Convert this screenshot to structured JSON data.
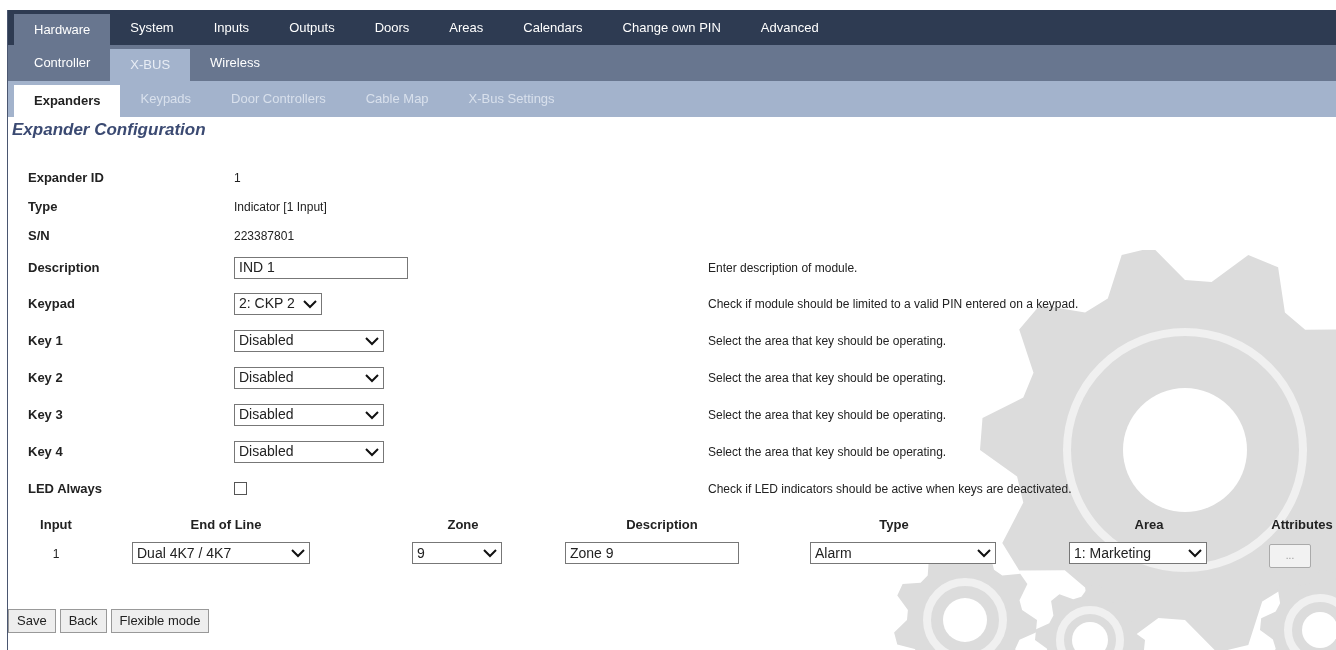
{
  "main_tabs": [
    {
      "label": "Hardware",
      "selected": true
    },
    {
      "label": "System",
      "selected": false
    },
    {
      "label": "Inputs",
      "selected": false
    },
    {
      "label": "Outputs",
      "selected": false
    },
    {
      "label": "Doors",
      "selected": false
    },
    {
      "label": "Areas",
      "selected": false
    },
    {
      "label": "Calendars",
      "selected": false
    },
    {
      "label": "Change own PIN",
      "selected": false
    },
    {
      "label": "Advanced",
      "selected": false
    }
  ],
  "sub_tabs": [
    {
      "label": "Controller",
      "selected": false
    },
    {
      "label": "X-BUS",
      "selected": true
    },
    {
      "label": "Wireless",
      "selected": false
    }
  ],
  "section_tabs": [
    {
      "label": "Expanders",
      "selected": true
    },
    {
      "label": "Keypads",
      "selected": false
    },
    {
      "label": "Door Controllers",
      "selected": false
    },
    {
      "label": "Cable Map",
      "selected": false
    },
    {
      "label": "X-Bus Settings",
      "selected": false
    }
  ],
  "heading": "Expander Configuration",
  "fields": [
    {
      "kind": "text",
      "label": "Expander ID",
      "value": "1"
    },
    {
      "kind": "text",
      "label": "Type",
      "value": "Indicator [1 Input]"
    },
    {
      "kind": "text",
      "label": "S/N",
      "value": "223387801"
    },
    {
      "kind": "input",
      "label": "Description",
      "value": "IND 1",
      "help": "Enter description of module."
    },
    {
      "kind": "select_small",
      "label": "Keypad",
      "value": "2: CKP 2",
      "help": "Check if module should be limited to a valid PIN entered on a keypad."
    },
    {
      "kind": "select",
      "label": "Key 1",
      "value": "Disabled",
      "help": "Select the area that key should be operating."
    },
    {
      "kind": "select",
      "label": "Key 2",
      "value": "Disabled",
      "help": "Select the area that key should be operating."
    },
    {
      "kind": "select",
      "label": "Key 3",
      "value": "Disabled",
      "help": "Select the area that key should be operating."
    },
    {
      "kind": "select",
      "label": "Key 4",
      "value": "Disabled",
      "help": "Select the area that key should be operating."
    },
    {
      "kind": "checkbox",
      "label": "LED Always",
      "checked": false,
      "help": "Check if LED indicators should be active when keys are deactivated."
    }
  ],
  "inputs_table": {
    "columns": [
      "Input",
      "End of Line",
      "Zone",
      "Description",
      "Type",
      "Area",
      "Attributes"
    ],
    "rows": [
      {
        "input": "1",
        "end_of_line": "Dual 4K7 / 4K7",
        "zone": "9",
        "description": "Zone 9",
        "type": "Alarm",
        "area": "1: Marketing",
        "attributes": "..."
      }
    ]
  },
  "buttons": [
    "Save",
    "Back",
    "Flexible mode"
  ]
}
